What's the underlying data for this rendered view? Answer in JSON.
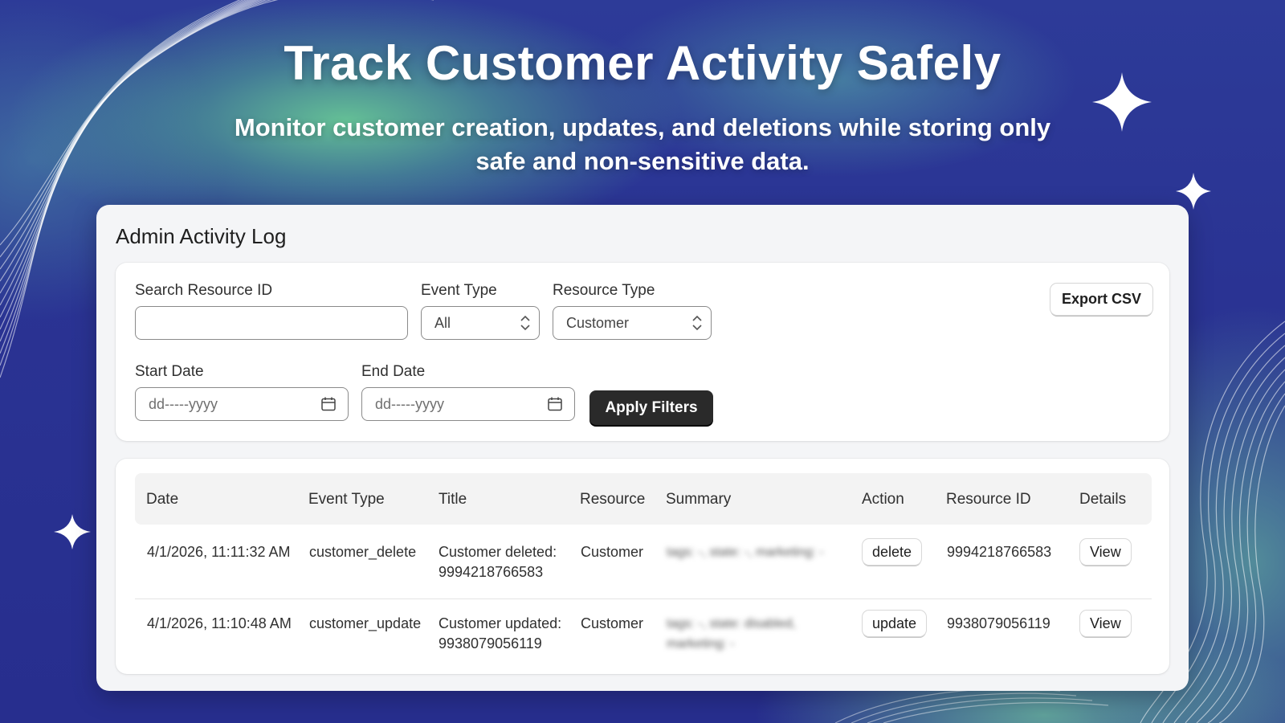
{
  "hero": {
    "title": "Track Customer Activity Safely",
    "subtitle": "Monitor customer creation, updates, and deletions while storing only safe and non-sensitive data."
  },
  "panel": {
    "title": "Admin Activity Log"
  },
  "filters": {
    "search_label": "Search Resource ID",
    "search_value": "",
    "event_type_label": "Event Type",
    "event_type_value": "All",
    "resource_type_label": "Resource Type",
    "resource_type_value": "Customer",
    "start_date_label": "Start Date",
    "start_date_placeholder": "dd-----yyyy",
    "end_date_label": "End Date",
    "end_date_placeholder": "dd-----yyyy",
    "apply_label": "Apply Filters",
    "export_label": "Export CSV"
  },
  "table": {
    "columns": [
      "Date",
      "Event Type",
      "Title",
      "Resource",
      "Summary",
      "Action",
      "Resource ID",
      "Details"
    ],
    "rows": [
      {
        "date": "4/1/2026, 11:11:32 AM",
        "event_type": "customer_delete",
        "title": "Customer deleted: 9994218766583",
        "resource": "Customer",
        "summary": "tags: -, state: -, marketing: -",
        "action": "delete",
        "resource_id": "9994218766583",
        "details": "View"
      },
      {
        "date": "4/1/2026, 11:10:48 AM",
        "event_type": "customer_update",
        "title": "Customer updated: 9938079056119",
        "resource": "Customer",
        "summary": "tags: -, state: disabled, marketing: -",
        "action": "update",
        "resource_id": "9938079056119",
        "details": "View"
      }
    ]
  },
  "colors": {
    "background": "#2a3393",
    "accent_green": "#6ed796",
    "dark_button": "#2a2a2a",
    "panel": "#f4f5f7"
  }
}
